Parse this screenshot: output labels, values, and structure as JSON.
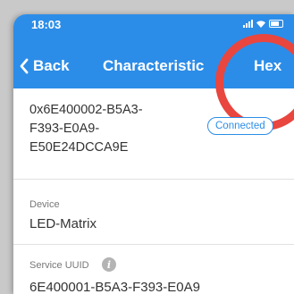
{
  "status_bar": {
    "time": "18:03"
  },
  "nav": {
    "back_label": "Back",
    "title": "Characteristic",
    "hex_label": "Hex"
  },
  "characteristic": {
    "uuid": "0x6E400002-B5A3-\nF393-E0A9-\nE50E24DCCA9E",
    "status": "Connected"
  },
  "device": {
    "label": "Device",
    "value": "LED-Matrix"
  },
  "service": {
    "label": "Service UUID",
    "value_partial": "6E400001-B5A3-F393-E0A9"
  },
  "colors": {
    "nav_bg": "#2c8de8",
    "highlight": "#e8463f",
    "badge": "#2c8de8"
  },
  "icons": [
    "signal-icon",
    "wifi-icon",
    "battery-icon",
    "chevron-left-icon",
    "info-icon"
  ]
}
